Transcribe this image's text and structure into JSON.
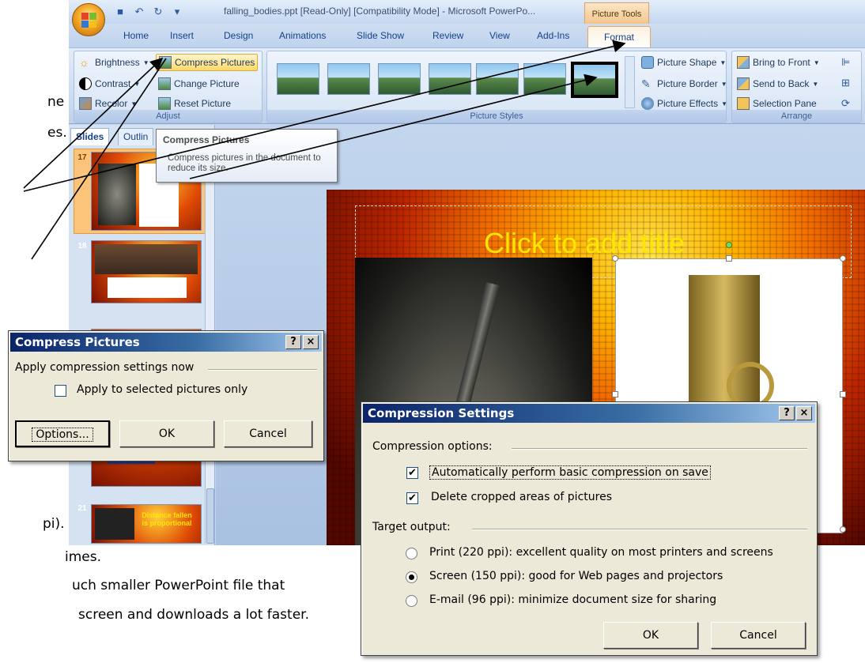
{
  "document": {
    "fragments": [
      "ne of",
      "es.",
      "pi).",
      "imes.",
      "uch smaller PowerPoint file that",
      "screen and downloads a lot faster."
    ]
  },
  "window": {
    "title": "falling_bodies.ppt [Read-Only] [Compatibility Mode] - Microsoft PowerPo...",
    "context_tab": "Picture Tools"
  },
  "tabs": [
    "Home",
    "Insert",
    "Design",
    "Animations",
    "Slide Show",
    "Review",
    "View",
    "Add-Ins",
    "Format"
  ],
  "ribbon": {
    "adjust": {
      "label": "Adjust",
      "buttons": [
        "Brightness",
        "Compress Pictures",
        "Contrast",
        "Change Picture",
        "Recolor",
        "Reset Picture"
      ]
    },
    "picture_styles": {
      "label": "Picture Styles",
      "buttons": [
        "Picture Shape",
        "Picture Border",
        "Picture Effects"
      ]
    },
    "arrange": {
      "label": "Arrange",
      "buttons": [
        "Bring to Front",
        "Send to Back",
        "Selection Pane"
      ]
    }
  },
  "tooltip": {
    "title": "Compress Pictures",
    "body": "Compress pictures in the document to reduce its size."
  },
  "slide_panel": {
    "tabs": [
      "Slides",
      "Outlin"
    ],
    "numbers": [
      "17",
      "18",
      "21"
    ],
    "thumb_21_text": "Distance fallen is proportional"
  },
  "slide": {
    "title_placeholder": "Click to add title"
  },
  "compress_dialog": {
    "title": "Compress Pictures",
    "group": "Apply compression settings now",
    "checkbox": "Apply to selected pictures only",
    "checkbox_checked": false,
    "buttons": [
      "Options...",
      "OK",
      "Cancel"
    ]
  },
  "compression_settings": {
    "title": "Compression Settings",
    "options_group": "Compression options:",
    "options": [
      {
        "label": "Automatically perform basic compression on save",
        "checked": true
      },
      {
        "label": "Delete cropped areas of pictures",
        "checked": true
      }
    ],
    "target_group": "Target output:",
    "targets": [
      {
        "label": "Print (220 ppi): excellent quality on most printers and screens",
        "selected": false
      },
      {
        "label": "Screen (150 ppi): good for Web pages and projectors",
        "selected": true
      },
      {
        "label": "E-mail (96 ppi): minimize document size for sharing",
        "selected": false
      }
    ],
    "buttons": [
      "OK",
      "Cancel"
    ]
  },
  "help_glyph": "?",
  "close_glyph": "×"
}
